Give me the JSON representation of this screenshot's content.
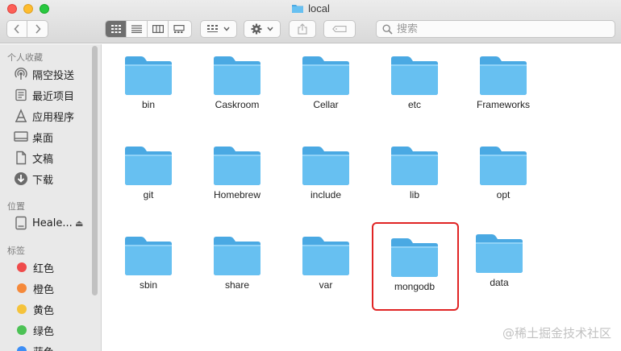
{
  "window": {
    "title": "local",
    "traffic_lights": {
      "close": "#fd5f57",
      "minimize": "#febc2e",
      "maximize": "#28c840"
    }
  },
  "toolbar": {
    "back_icon": "chevron-left-icon",
    "forward_icon": "chevron-right-icon",
    "view_modes": [
      "icon-view-icon",
      "list-view-icon",
      "column-view-icon",
      "gallery-view-icon"
    ],
    "active_view": "icon-view-icon",
    "group_icon": "group-icon",
    "action_icon": "gear-icon",
    "share_icon": "share-icon",
    "tag_icon": "tag-icon",
    "search_placeholder": "搜索"
  },
  "sidebar": {
    "favorites_header": "个人收藏",
    "favorites": [
      {
        "label": "隔空投送",
        "icon": "airdrop-icon"
      },
      {
        "label": "最近项目",
        "icon": "recents-icon"
      },
      {
        "label": "应用程序",
        "icon": "applications-icon"
      },
      {
        "label": "桌面",
        "icon": "desktop-icon"
      },
      {
        "label": "文稿",
        "icon": "documents-icon"
      },
      {
        "label": "下载",
        "icon": "downloads-icon"
      }
    ],
    "locations_header": "位置",
    "locations": [
      {
        "label": "Heale...",
        "icon": "disk-icon"
      }
    ],
    "tags_header": "标签",
    "tags": [
      {
        "label": "红色",
        "color": "#ef4b4b"
      },
      {
        "label": "橙色",
        "color": "#f5893a"
      },
      {
        "label": "黄色",
        "color": "#f5c33b"
      },
      {
        "label": "绿色",
        "color": "#4cc255"
      },
      {
        "label": "蓝色",
        "color": "#3d8ef5"
      }
    ]
  },
  "folder_colors": {
    "front": "#67c0f1",
    "back": "#4aa9e3"
  },
  "files": [
    "bin",
    "Caskroom",
    "Cellar",
    "etc",
    "Frameworks",
    "git",
    "Homebrew",
    "include",
    "lib",
    "opt",
    "sbin",
    "share",
    "var",
    "mongodb",
    "data"
  ],
  "highlighted_file": "mongodb",
  "highlight_color": "#e02424",
  "watermark": "@稀土掘金技术社区"
}
